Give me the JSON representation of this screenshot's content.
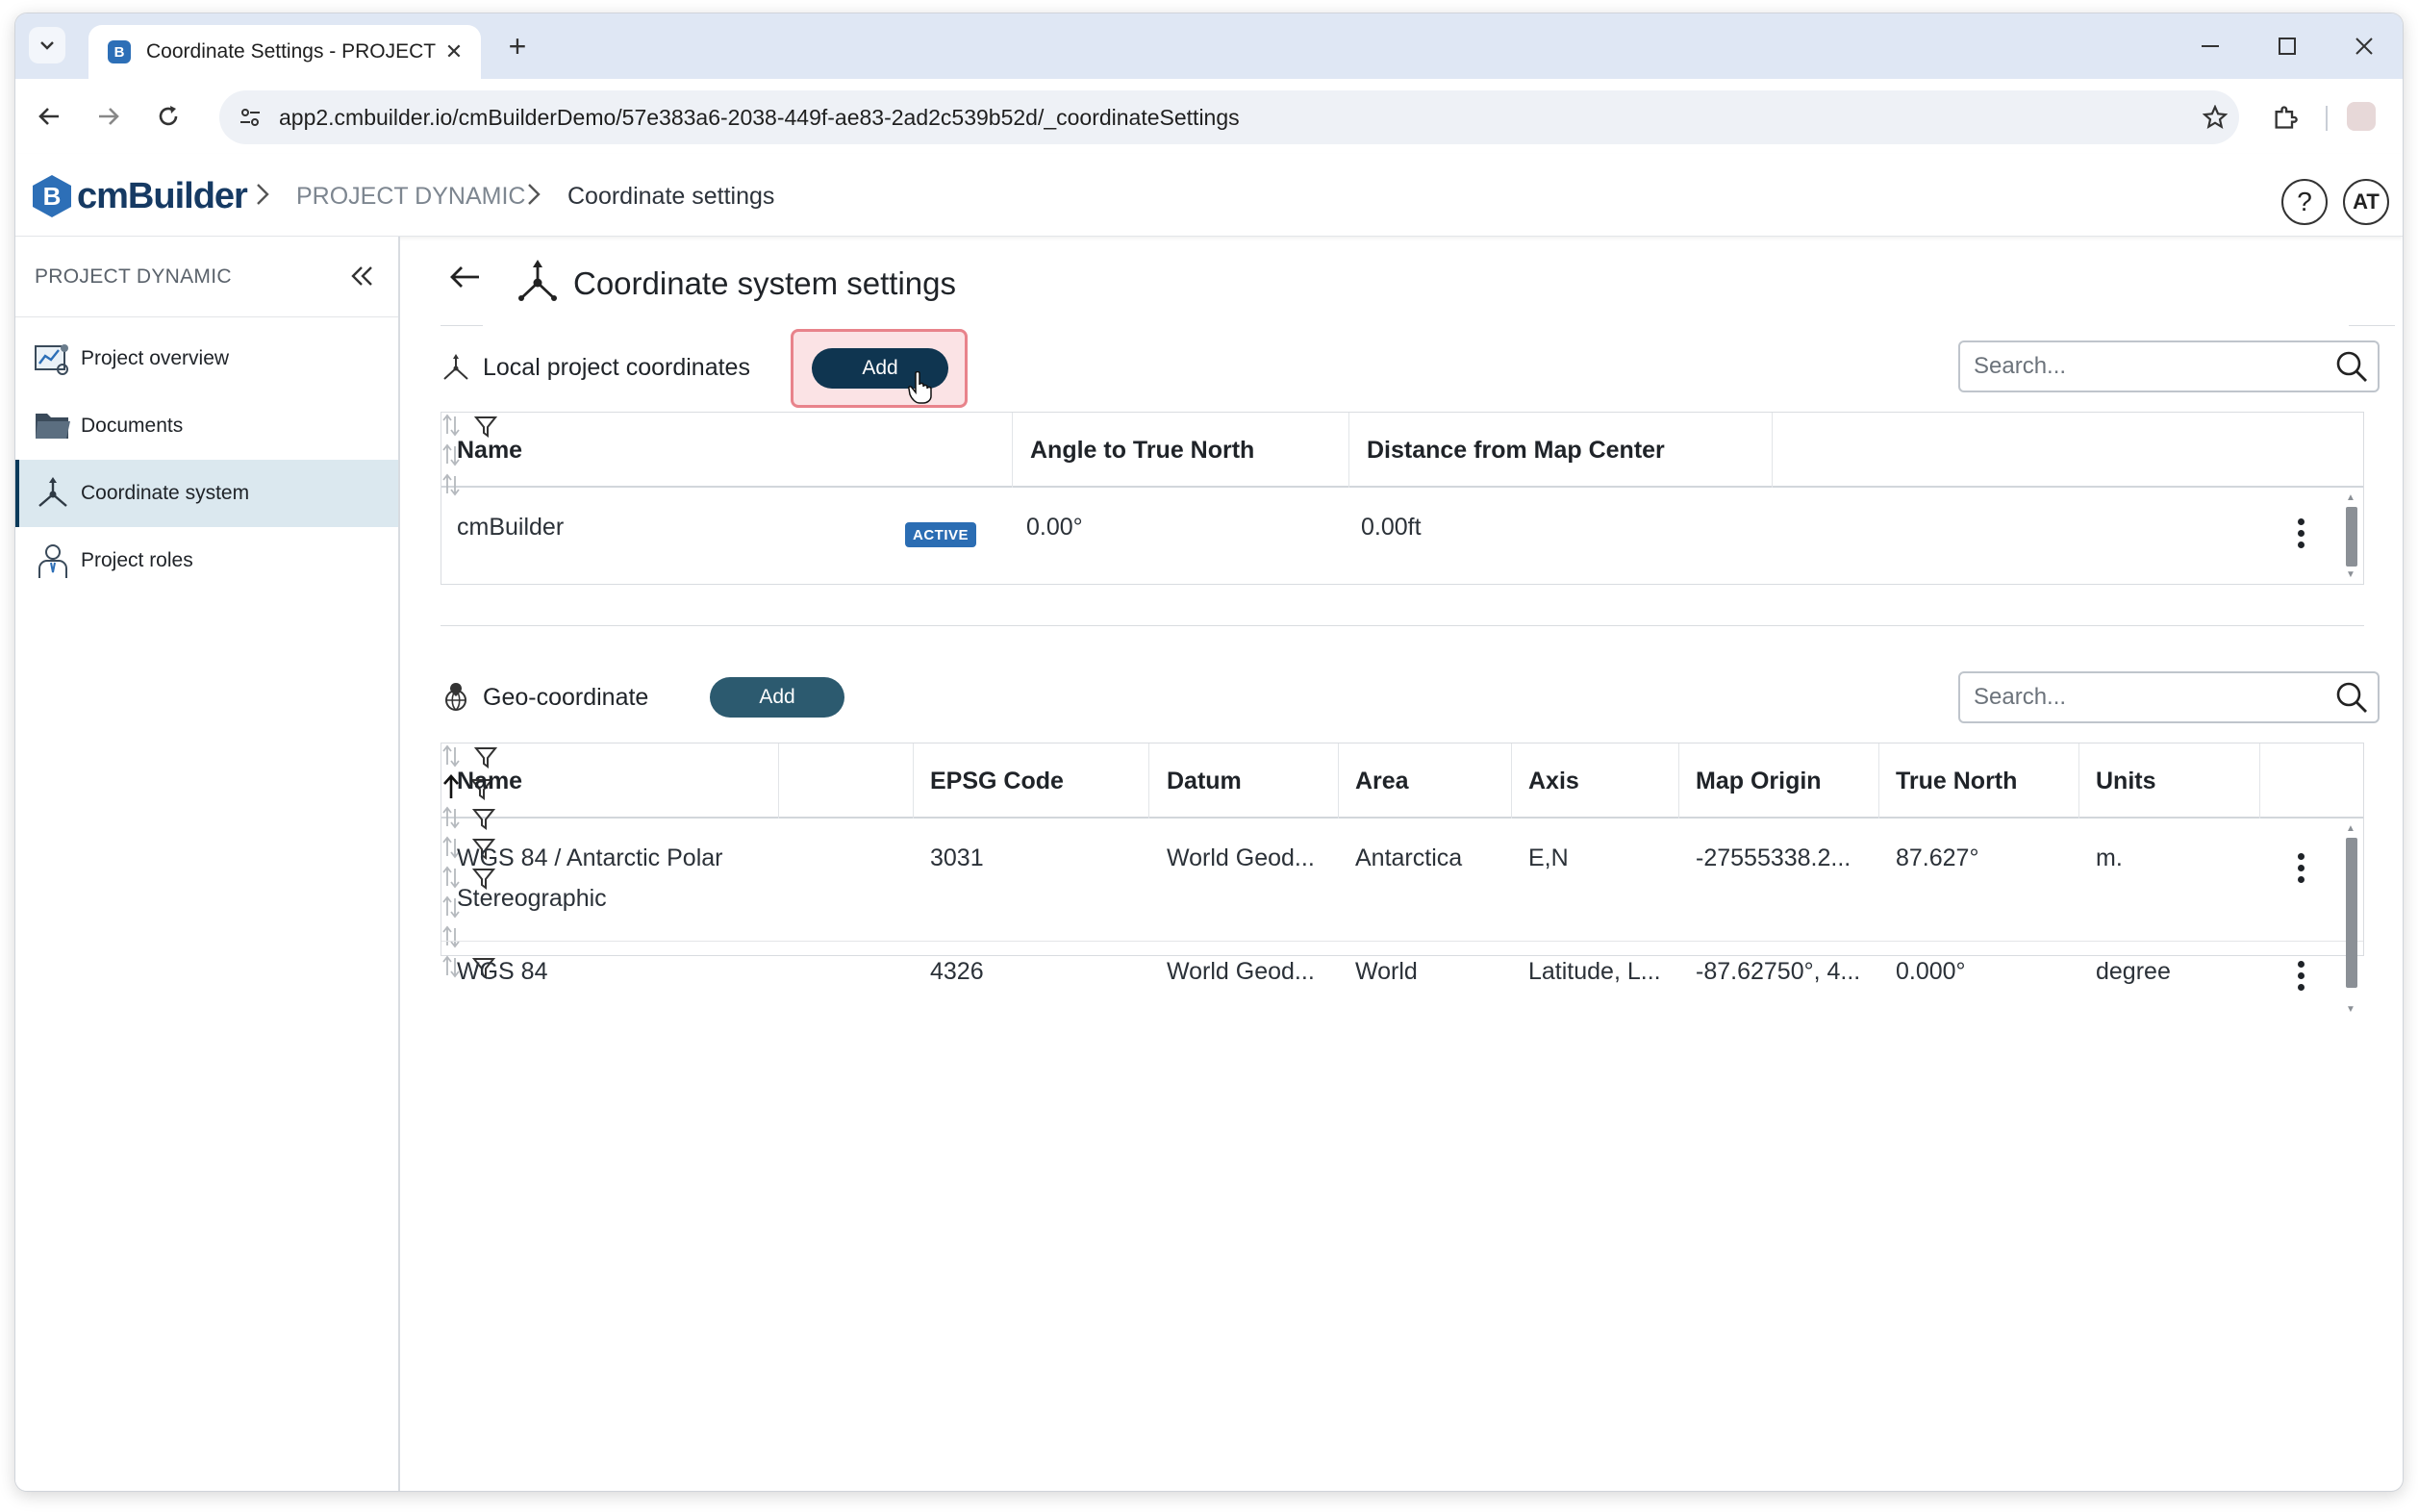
{
  "browser": {
    "tab_title": "Coordinate Settings - PROJECT",
    "url": "app2.cmbuilder.io/cmBuilderDemo/57e383a6-2038-449f-ae83-2ad2c539b52d/_coordinateSettings"
  },
  "header": {
    "logo_mark": "B",
    "logo_text": "cmBuilder",
    "breadcrumb": [
      "PROJECT DYNAMIC",
      "Coordinate settings"
    ],
    "help": "?",
    "avatar": "AT"
  },
  "sidebar": {
    "title": "PROJECT DYNAMIC",
    "items": [
      {
        "label": "Project overview",
        "icon": "chart-dashboard-icon"
      },
      {
        "label": "Documents",
        "icon": "folder-icon"
      },
      {
        "label": "Coordinate system",
        "icon": "axes-icon",
        "active": true
      },
      {
        "label": "Project roles",
        "icon": "person-icon"
      }
    ]
  },
  "main": {
    "title": "Coordinate system settings",
    "local": {
      "label": "Local project coordinates",
      "add_label": "Add",
      "search_placeholder": "Search...",
      "columns": [
        "Name",
        "",
        "Angle to True North",
        "Distance from Map Center"
      ],
      "rows": [
        {
          "name": "cmBuilder",
          "status": "ACTIVE",
          "angle": "0.00°",
          "distance": "0.00ft"
        }
      ]
    },
    "geo": {
      "label": "Geo-coordinate",
      "add_label": "Add",
      "search_placeholder": "Search...",
      "columns": [
        "Name",
        "EPSG Code",
        "Datum",
        "Area",
        "Axis",
        "Map Origin",
        "True North",
        "Units"
      ],
      "rows": [
        {
          "name": "WGS 84 / Antarctic Polar Stereographic",
          "name_line1": "WGS 84 / Antarctic Polar",
          "name_line2": "Stereographic",
          "epsg": "3031",
          "datum": "World Geod...",
          "area": "Antarctica",
          "axis": "E,N",
          "origin": "-27555338.2...",
          "north": "87.627°",
          "units": "m."
        },
        {
          "name": "WGS 84",
          "epsg": "4326",
          "datum": "World Geod...",
          "area": "World",
          "axis": "Latitude, L...",
          "origin": "-87.62750°, 4...",
          "north": "0.000°",
          "units": "degree"
        }
      ]
    }
  }
}
